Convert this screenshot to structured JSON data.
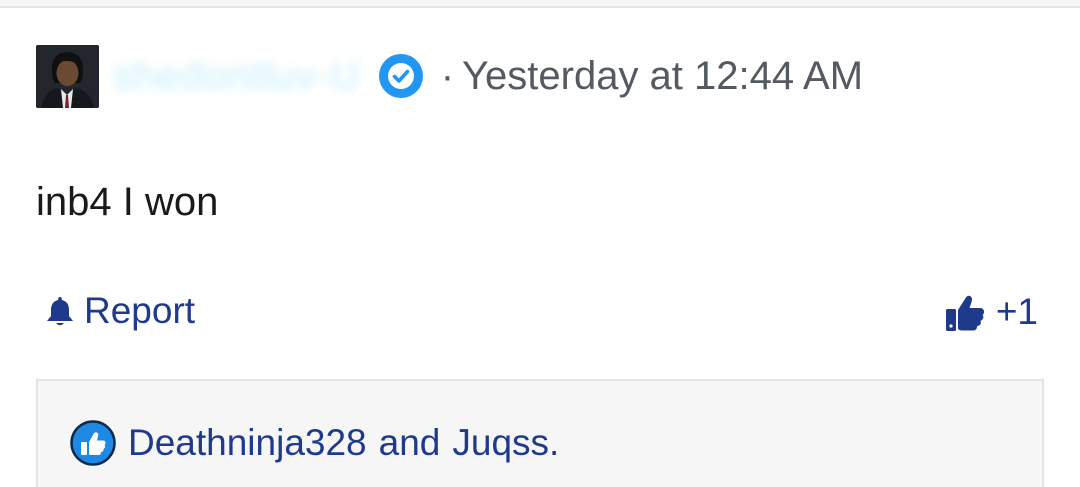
{
  "post": {
    "author": {
      "username": "shedontluv-U",
      "verified": true,
      "avatar_icon": "profile-photo"
    },
    "timestamp": "Yesterday at 12:44 AM",
    "separator": "·",
    "message": "inb4 I won"
  },
  "actions": {
    "report_label": "Report",
    "report_icon": "bell-icon",
    "like_count_label": "+1",
    "like_icon": "thumbs-up-icon"
  },
  "reactions": {
    "icon": "like-badge-icon",
    "users": [
      "Deathninja328",
      "Juqss."
    ],
    "conjunction": "and"
  },
  "colors": {
    "link": "#1f3a8a",
    "verified_badge": "#2196f3",
    "meta_text": "#555a61",
    "username_blurred": "#c4eefa",
    "reactions_bg": "#f6f6f6"
  }
}
